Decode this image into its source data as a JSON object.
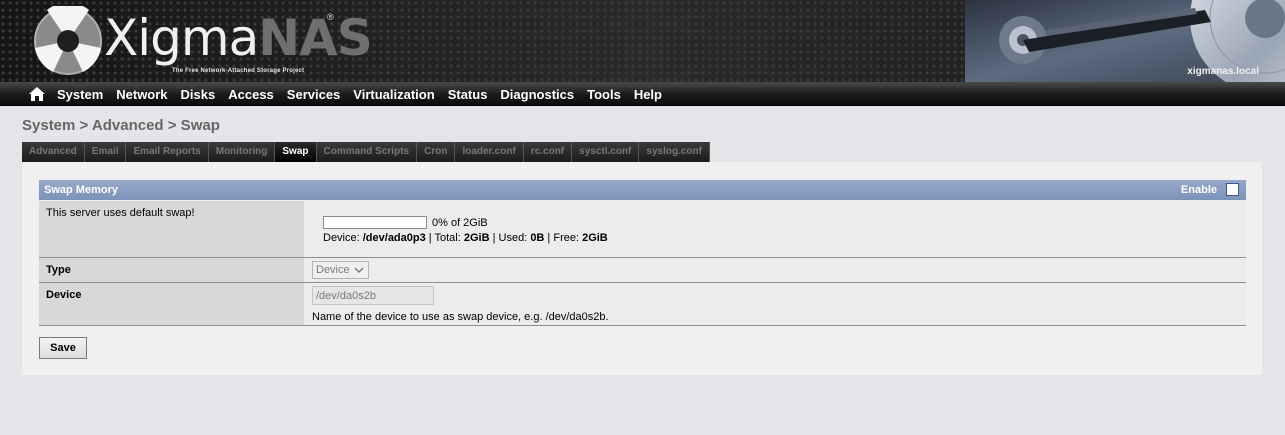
{
  "header": {
    "logo_xigma": "Xigma",
    "logo_nas": "NAS",
    "logo_reg": "®",
    "tagline": "The Free Network-Attached Storage Project",
    "hostname": "xigmanas.local"
  },
  "nav": {
    "home_icon": "home-icon",
    "items": [
      "System",
      "Network",
      "Disks",
      "Access",
      "Services",
      "Virtualization",
      "Status",
      "Diagnostics",
      "Tools",
      "Help"
    ]
  },
  "breadcrumb": "System > Advanced > Swap",
  "tabs": [
    {
      "label": "Advanced",
      "active": false
    },
    {
      "label": "Email",
      "active": false
    },
    {
      "label": "Email Reports",
      "active": false
    },
    {
      "label": "Monitoring",
      "active": false
    },
    {
      "label": "Swap",
      "active": true
    },
    {
      "label": "Command Scripts",
      "active": false
    },
    {
      "label": "Cron",
      "active": false
    },
    {
      "label": "loader.conf",
      "active": false
    },
    {
      "label": "rc.conf",
      "active": false
    },
    {
      "label": "sysctl.conf",
      "active": false
    },
    {
      "label": "syslog.conf",
      "active": false
    }
  ],
  "section": {
    "title": "Swap Memory",
    "enable_label": "Enable",
    "enable_checked": false
  },
  "swap_status": {
    "message": "This server uses default swap!",
    "usage_fraction": 0,
    "usage_text": "0% of 2GiB",
    "device_label": "Device: ",
    "device": "/dev/ada0p3",
    "total_label": " | Total: ",
    "total": "2GiB",
    "used_label": " | Used: ",
    "used": "0B",
    "free_label": " | Free: ",
    "free": "2GiB"
  },
  "type_field": {
    "label": "Type",
    "value": "Device"
  },
  "device_field": {
    "label": "Device",
    "value": "/dev/da0s2b",
    "hint": "Name of the device to use as swap device, e.g. /dev/da0s2b."
  },
  "save_label": "Save",
  "colors": {
    "section_header": "#8a9ec2",
    "progress_fill": "#6d86b0"
  }
}
